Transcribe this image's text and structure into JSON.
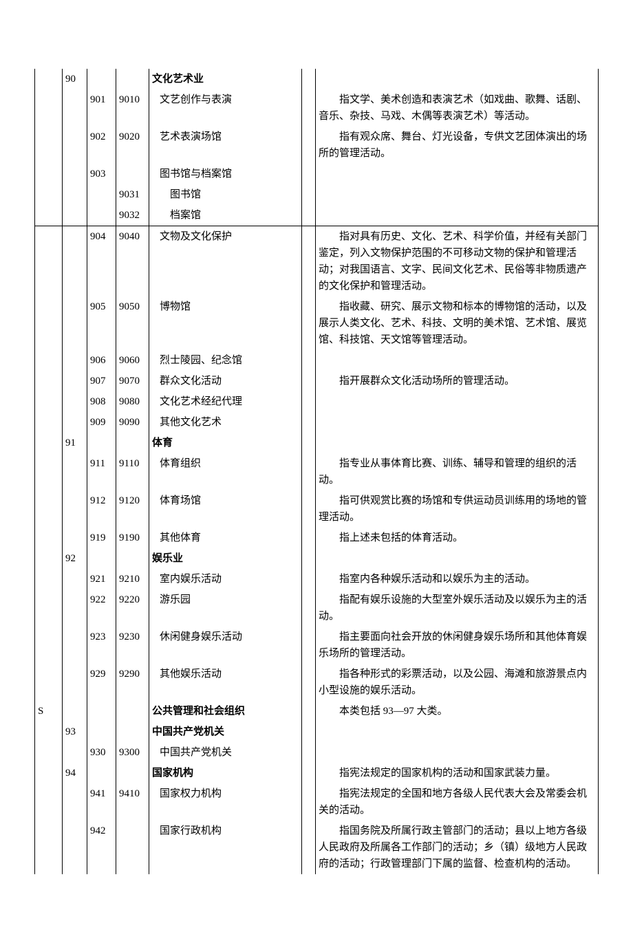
{
  "rows": [
    {
      "c1": "",
      "c2": "90",
      "c3": "",
      "c4": "",
      "name": "文化艺术业",
      "nameClass": "bold",
      "desc": ""
    },
    {
      "c1": "",
      "c2": "",
      "c3": "901",
      "c4": "9010",
      "name": "文艺创作与表演",
      "nameClass": "indent1",
      "desc": "指文学、美术创造和表演艺术（如戏曲、歌舞、话剧、音乐、杂技、马戏、木偶等表演艺术）等活动。"
    },
    {
      "c1": "",
      "c2": "",
      "c3": "902",
      "c4": "9020",
      "name": "艺术表演场馆",
      "nameClass": "indent1",
      "desc": "指有观众席、舞台、灯光设备，专供文艺团体演出的场所的管理活动。"
    },
    {
      "c1": "",
      "c2": "",
      "c3": "903",
      "c4": "",
      "name": "图书馆与档案馆",
      "nameClass": "indent1",
      "desc": ""
    },
    {
      "c1": "",
      "c2": "",
      "c3": "",
      "c4": "9031",
      "name": "图书馆",
      "nameClass": "indent2",
      "desc": ""
    },
    {
      "c1": "",
      "c2": "",
      "c3": "",
      "c4": "9032",
      "name": "档案馆",
      "nameClass": "indent2",
      "desc": ""
    },
    {
      "sec": true,
      "c1": "",
      "c2": "",
      "c3": "904",
      "c4": "9040",
      "name": "文物及文化保护",
      "nameClass": "indent1",
      "desc": "指对具有历史、文化、艺术、科学价值，并经有关部门鉴定，列入文物保护范围的不可移动文物的保护和管理活动；对我国语言、文字、民间文化艺术、民俗等非物质遗产的文化保护和管理活动。"
    },
    {
      "c1": "",
      "c2": "",
      "c3": "905",
      "c4": "9050",
      "name": "博物馆",
      "nameClass": "indent1",
      "desc": "指收藏、研究、展示文物和标本的博物馆的活动，以及展示人类文化、艺术、科技、文明的美术馆、艺术馆、展览馆、科技馆、天文馆等管理活动。"
    },
    {
      "c1": "",
      "c2": "",
      "c3": "906",
      "c4": "9060",
      "name": "烈士陵园、纪念馆",
      "nameClass": "indent1",
      "desc": ""
    },
    {
      "c1": "",
      "c2": "",
      "c3": "907",
      "c4": "9070",
      "name": "群众文化活动",
      "nameClass": "indent1",
      "desc": "指开展群众文化活动场所的管理活动。"
    },
    {
      "c1": "",
      "c2": "",
      "c3": "908",
      "c4": "9080",
      "name": "文化艺术经纪代理",
      "nameClass": "indent1",
      "desc": ""
    },
    {
      "c1": "",
      "c2": "",
      "c3": "909",
      "c4": "9090",
      "name": "其他文化艺术",
      "nameClass": "indent1",
      "desc": ""
    },
    {
      "c1": "",
      "c2": "91",
      "c3": "",
      "c4": "",
      "name": "体育",
      "nameClass": "bold",
      "desc": ""
    },
    {
      "c1": "",
      "c2": "",
      "c3": "911",
      "c4": "9110",
      "name": "体育组织",
      "nameClass": "indent1",
      "desc": "指专业从事体育比赛、训练、辅导和管理的组织的活动。"
    },
    {
      "c1": "",
      "c2": "",
      "c3": "912",
      "c4": "9120",
      "name": "体育场馆",
      "nameClass": "indent1",
      "desc": "指可供观赏比赛的场馆和专供运动员训练用的场地的管理活动。"
    },
    {
      "c1": "",
      "c2": "",
      "c3": "919",
      "c4": "9190",
      "name": "其他体育",
      "nameClass": "indent1",
      "desc": "指上述未包括的体育活动。"
    },
    {
      "c1": "",
      "c2": "92",
      "c3": "",
      "c4": "",
      "name": "娱乐业",
      "nameClass": "bold",
      "desc": ""
    },
    {
      "c1": "",
      "c2": "",
      "c3": "921",
      "c4": "9210",
      "name": "室内娱乐活动",
      "nameClass": "indent1",
      "desc": "指室内各种娱乐活动和以娱乐为主的活动。"
    },
    {
      "c1": "",
      "c2": "",
      "c3": "922",
      "c4": "9220",
      "name": "游乐园",
      "nameClass": "indent1",
      "desc": "指配有娱乐设施的大型室外娱乐活动及以娱乐为主的活动。"
    },
    {
      "c1": "",
      "c2": "",
      "c3": "923",
      "c4": "9230",
      "name": "休闲健身娱乐活动",
      "nameClass": "indent1",
      "desc": "指主要面向社会开放的休闲健身娱乐场所和其他体育娱乐场所的管理活动。"
    },
    {
      "c1": "",
      "c2": "",
      "c3": "929",
      "c4": "9290",
      "name": "其他娱乐活动",
      "nameClass": "indent1",
      "desc": "指各种形式的彩票活动，以及公园、海滩和旅游景点内小型设施的娱乐活动。"
    },
    {
      "c1": "S",
      "c2": "",
      "c3": "",
      "c4": "",
      "name": "公共管理和社会组织",
      "nameClass": "bold",
      "desc": "本类包括 93—97 大类。"
    },
    {
      "c1": "",
      "c2": "93",
      "c3": "",
      "c4": "",
      "name": "中国共产党机关",
      "nameClass": "bold",
      "desc": ""
    },
    {
      "c1": "",
      "c2": "",
      "c3": "930",
      "c4": "9300",
      "name": "中国共产党机关",
      "nameClass": "indent1",
      "desc": ""
    },
    {
      "c1": "",
      "c2": "94",
      "c3": "",
      "c4": "",
      "name": "国家机构",
      "nameClass": "bold",
      "desc": "指宪法规定的国家机构的活动和国家武装力量。"
    },
    {
      "c1": "",
      "c2": "",
      "c3": "941",
      "c4": "9410",
      "name": "国家权力机构",
      "nameClass": "indent1",
      "desc": "指宪法规定的全国和地方各级人民代表大会及常委会机关的活动。"
    },
    {
      "c1": "",
      "c2": "",
      "c3": "942",
      "c4": "",
      "name": "国家行政机构",
      "nameClass": "indent1",
      "desc": "指国务院及所属行政主管部门的活动；县以上地方各级人民政府及所属各工作部门的活动；乡（镇）级地方人民政府的活动；行政管理部门下属的监督、检查机构的活动。"
    }
  ]
}
